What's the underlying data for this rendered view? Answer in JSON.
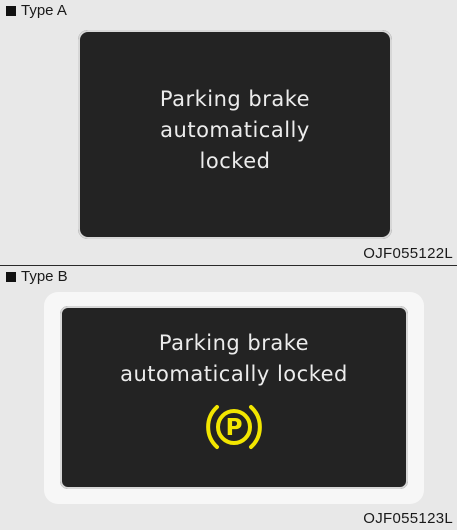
{
  "panel_a": {
    "label": "Type A",
    "message_lines": [
      "Parking brake",
      "automatically",
      "locked"
    ],
    "code": "OJF055122L"
  },
  "panel_b": {
    "label": "Type B",
    "message_lines": [
      "Parking brake",
      "automatically locked"
    ],
    "icon": {
      "name": "parking-brake-icon",
      "letter": "P",
      "color": "#f2e600"
    },
    "code": "OJF055123L"
  }
}
